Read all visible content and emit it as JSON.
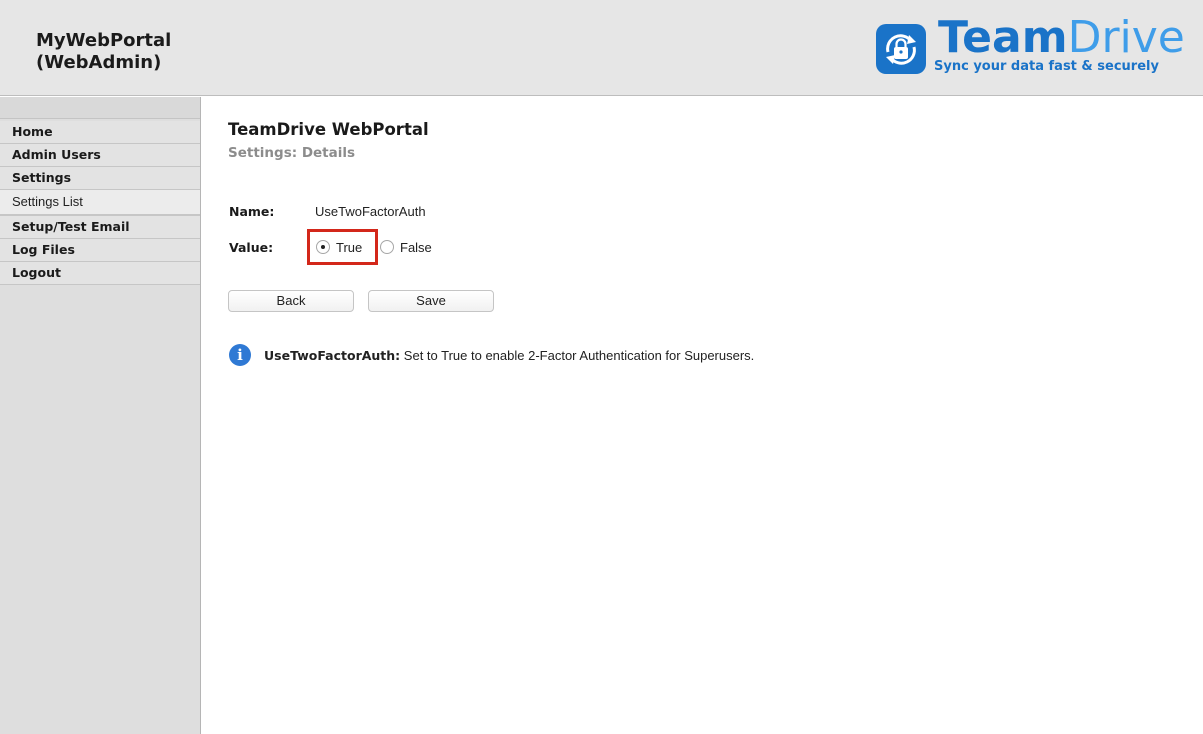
{
  "header": {
    "portal_title": "MyWebPortal\n(WebAdmin)",
    "logo": {
      "brand_team": "Team",
      "brand_drive": "Drive",
      "tagline": "Sync your data fast & securely",
      "icon": "lock-sync-icon"
    }
  },
  "sidebar": {
    "items": [
      {
        "label": "Home"
      },
      {
        "label": "Admin Users"
      },
      {
        "label": "Settings"
      },
      {
        "label": "Settings List"
      },
      {
        "label": "Setup/Test Email"
      },
      {
        "label": "Log Files"
      },
      {
        "label": "Logout"
      }
    ]
  },
  "main": {
    "title": "TeamDrive WebPortal",
    "subtitle": "Settings: Details",
    "name_label": "Name:",
    "name_value": "UseTwoFactorAuth",
    "value_label": "Value:",
    "options": [
      {
        "label": "True",
        "selected": true
      },
      {
        "label": "False",
        "selected": false
      }
    ],
    "buttons": {
      "back": "Back",
      "save": "Save"
    },
    "info": {
      "key": "UseTwoFactorAuth:",
      "text": " Set to True to enable 2-Factor Authentication for Superusers."
    }
  },
  "colors": {
    "brand": "#1a73c8",
    "highlight": "#d3271a",
    "info_icon": "#2f79d4"
  }
}
